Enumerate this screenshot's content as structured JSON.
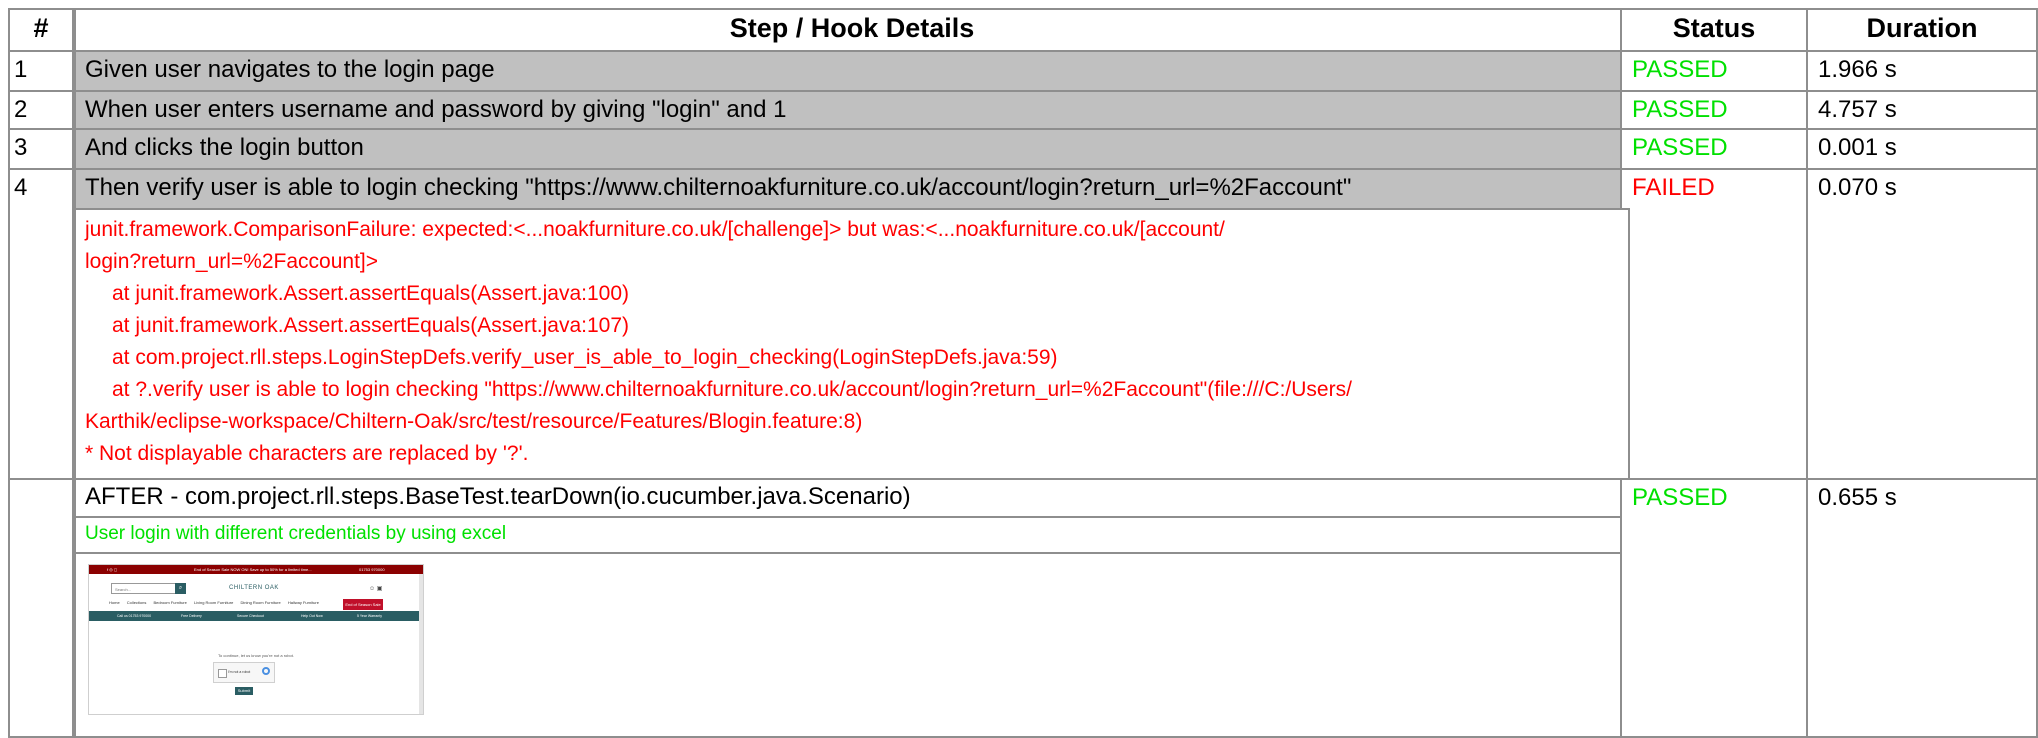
{
  "table": {
    "headers": {
      "num": "#",
      "details": "Step / Hook Details",
      "status": "Status",
      "duration": "Duration"
    },
    "rows": [
      {
        "num": "1",
        "step": "Given user navigates to the login page",
        "status": "PASSED",
        "duration": "1.966 s"
      },
      {
        "num": "2",
        "step": "When user enters username and password by giving \"login\" and 1",
        "status": "PASSED",
        "duration": "4.757 s"
      },
      {
        "num": "3",
        "step": "And clicks the login button",
        "status": "PASSED",
        "duration": "0.001 s"
      },
      {
        "num": "4",
        "step": "Then verify user is able to login checking \"https://www.chilternoakfurniture.co.uk/account/login?return_url=%2Faccount\"",
        "status": "FAILED",
        "duration": "0.070 s"
      }
    ],
    "error_lines": [
      "junit.framework.ComparisonFailure: expected:<...noakfurniture.co.uk/[challenge]> but was:<...noakfurniture.co.uk/[account/",
      "login?return_url=%2Faccount]>",
      "at junit.framework.Assert.assertEquals(Assert.java:100)",
      "at junit.framework.Assert.assertEquals(Assert.java:107)",
      "at com.project.rll.steps.LoginStepDefs.verify_user_is_able_to_login_checking(LoginStepDefs.java:59)",
      "at ?.verify user is able to login checking \"https://www.chilternoakfurniture.co.uk/account/login?return_url=%2Faccount\"(file:///C:/Users/",
      "Karthik/eclipse-workspace/Chiltern-Oak/src/test/resource/Features/Blogin.feature:8)",
      "* Not displayable characters are replaced by '?'."
    ],
    "hook": {
      "label": "AFTER - com.project.rll.steps.BaseTest.tearDown(io.cucumber.java.Scenario)",
      "status": "PASSED",
      "duration": "0.655 s",
      "embed_text": "User login with different credentials by using excel"
    }
  },
  "screenshot_thumb": {
    "top_banner": "End of Season Sale NOW ON! Save up to 50% for a limited time...",
    "phone": "01753 970000",
    "search_placeholder": "Search...",
    "logo_text": "CHILTERN OAK",
    "menu": [
      "Home",
      "Collections",
      "Bedroom Furniture",
      "Living Room Furniture",
      "Dining Room Furniture",
      "Hallway Furniture"
    ],
    "sale_tab": "End of Season Sale",
    "bar_items": [
      "Call us 01753 970000",
      "Free Delivery",
      "Secure Checkout",
      "Help Out Now",
      "5 Year Warranty"
    ],
    "message": "To continue, let us know you're not a robot.",
    "captcha_text": "I'm not a robot",
    "submit_label": "Submit"
  },
  "colors": {
    "passed": "#00e000",
    "failed": "#ff0000",
    "step_bg": "#c0c0c0",
    "border": "#8e8e8e"
  }
}
